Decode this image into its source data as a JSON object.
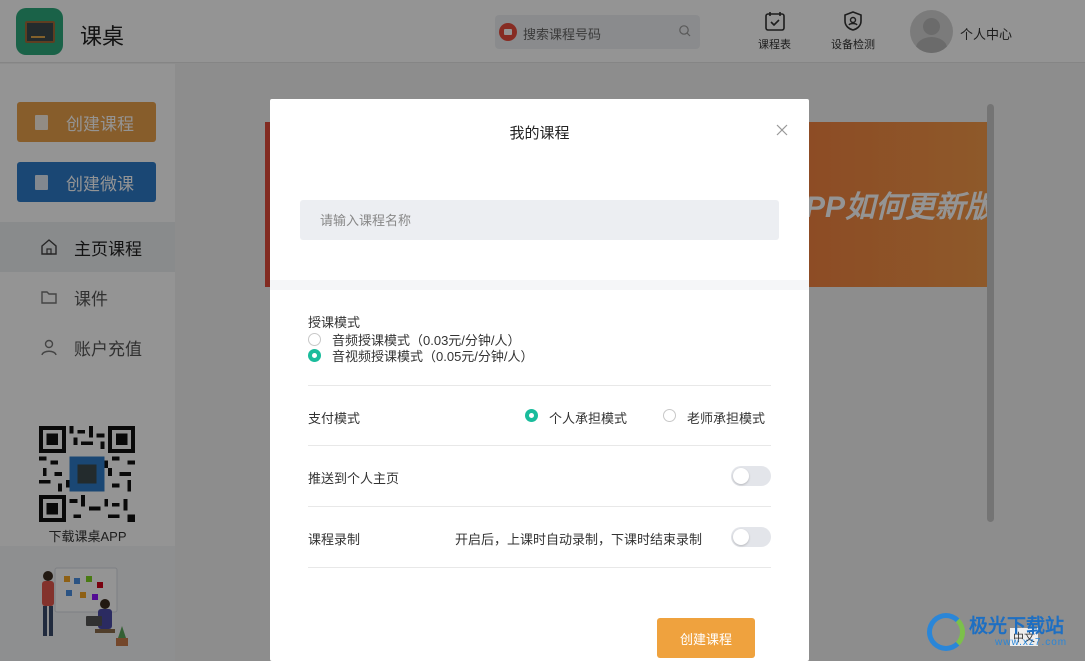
{
  "app": {
    "name": "课桌",
    "logo_icon": "blackboard-icon"
  },
  "header": {
    "search_placeholder": "搜索课程号码",
    "schedule_label": "课程表",
    "device_check_label": "设备检测",
    "user_center_label": "个人中心"
  },
  "sidebar": {
    "create_course_label": "创建课程",
    "create_micro_label": "创建微课",
    "nav": [
      {
        "label": "主页课程",
        "icon": "home-icon",
        "active": true
      },
      {
        "label": "课件",
        "icon": "folder-icon",
        "active": false
      },
      {
        "label": "账户充值",
        "icon": "user-icon",
        "active": false
      }
    ],
    "download_label": "下载课桌APP"
  },
  "banner": {
    "text": "PP如何更新版"
  },
  "modal": {
    "title": "我的课程",
    "name_placeholder": "请输入课程名称",
    "teaching_mode": {
      "label": "授课模式",
      "options": [
        {
          "label": "音频授课模式（0.03元/分钟/人）",
          "selected": false
        },
        {
          "label": "音视频授课模式（0.05元/分钟/人）",
          "selected": true
        }
      ]
    },
    "payment_mode": {
      "label": "支付模式",
      "options": [
        {
          "label": "个人承担模式",
          "selected": true
        },
        {
          "label": "老师承担模式",
          "selected": false
        }
      ]
    },
    "push_home": {
      "label": "推送到个人主页",
      "enabled": false
    },
    "recording": {
      "label": "课程录制",
      "hint": "开启后，上课时自动录制，下课时结束录制",
      "enabled": false
    },
    "submit_label": "创建课程"
  },
  "watermark": {
    "text": "极光下载站",
    "url": "www.xz7.com"
  },
  "language": "中文",
  "colors": {
    "accent_orange": "#efa23e",
    "accent_blue": "#2e7bc8",
    "radio_green": "#1abc9c"
  }
}
